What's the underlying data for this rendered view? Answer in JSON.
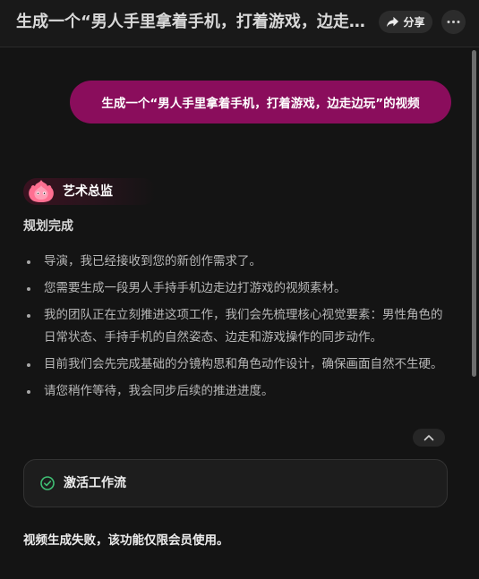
{
  "header": {
    "title": "生成一个“男人手里拿着手机，打着游戏，边走边玩”的视频",
    "share_label": "分享",
    "share_icon": "share-arrow-icon",
    "more_icon": "more-dots-icon"
  },
  "chat": {
    "user_message": "生成一个“男人手里拿着手机，打着游戏，边走边玩”的视频",
    "agent": {
      "name": "艺术总监",
      "avatar_icon": "flame-mascot-icon",
      "status": "规划完成",
      "bullets": [
        "导演，我已经接收到您的新创作需求了。",
        "您需要生成一段男人手持手机边走边打游戏的视频素材。",
        "我的团队正在立刻推进这项工作，我们会先梳理核心视觉要素：男性角色的日常状态、手持手机的自然姿态、边走和游戏操作的同步动作。",
        "目前我们会先完成基础的分镜构思和角色动作设计，确保画面自然不生硬。",
        "请您稍作等待，我会同步后续的推进进度。"
      ],
      "collapse_icon": "chevron-up-icon"
    },
    "workflow": {
      "label": "激活工作流",
      "icon": "check-circle-icon"
    },
    "error_message": "视频生成失败，该功能仅限会员使用。"
  },
  "colors": {
    "background": "#141414",
    "user_bubble": "#8a0d5c",
    "check_green": "#3fbf74",
    "mascot_pink": "#ff6f91"
  }
}
